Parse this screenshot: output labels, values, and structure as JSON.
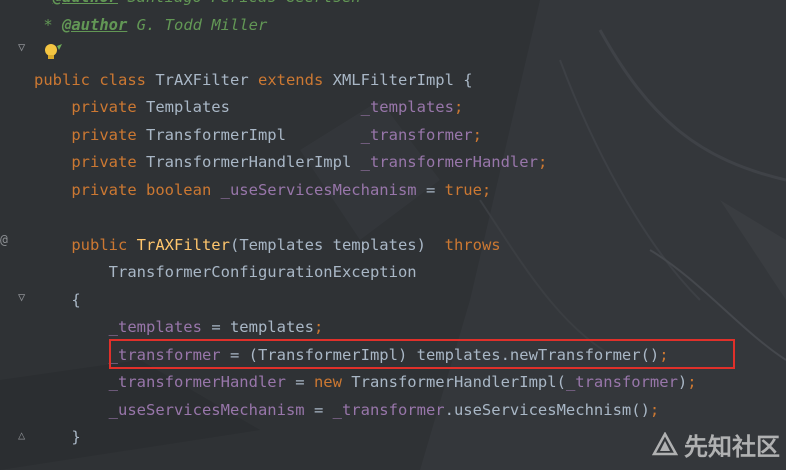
{
  "editor": {
    "lines": [
      {
        "segments": [
          {
            "cls": "cmt",
            "text": "  "
          },
          {
            "cls": "tag",
            "text": "@author"
          },
          {
            "cls": "cmt",
            "text": " Santiago Pericas-Geertsen"
          }
        ]
      },
      {
        "segments": [
          {
            "cls": "cmt",
            "text": " * "
          },
          {
            "cls": "tag",
            "text": "@author"
          },
          {
            "cls": "cmt",
            "text": " G. Todd Miller"
          }
        ]
      },
      {
        "segments": []
      },
      {
        "segments": [
          {
            "cls": "kw",
            "text": "public class "
          },
          {
            "cls": "cls",
            "text": "TrAXFilter "
          },
          {
            "cls": "kw",
            "text": "extends "
          },
          {
            "cls": "cls",
            "text": "XMLFilterImpl {"
          }
        ]
      },
      {
        "segments": [
          {
            "cls": "kw",
            "text": "    private "
          },
          {
            "cls": "cls",
            "text": "Templates              "
          },
          {
            "cls": "fld",
            "text": "_templates"
          },
          {
            "cls": "kw",
            "text": ";"
          }
        ]
      },
      {
        "segments": [
          {
            "cls": "kw",
            "text": "    private "
          },
          {
            "cls": "cls",
            "text": "TransformerImpl        "
          },
          {
            "cls": "fld",
            "text": "_transformer"
          },
          {
            "cls": "kw",
            "text": ";"
          }
        ]
      },
      {
        "segments": [
          {
            "cls": "kw",
            "text": "    private "
          },
          {
            "cls": "cls",
            "text": "TransformerHandlerImpl "
          },
          {
            "cls": "fld",
            "text": "_transformerHandler"
          },
          {
            "cls": "kw",
            "text": ";"
          }
        ]
      },
      {
        "segments": [
          {
            "cls": "kw",
            "text": "    private boolean "
          },
          {
            "cls": "fld",
            "text": "_useServicesMechanism"
          },
          {
            "cls": "plain",
            "text": " = "
          },
          {
            "cls": "kw",
            "text": "true;"
          }
        ]
      },
      {
        "segments": []
      },
      {
        "segments": [
          {
            "cls": "kw",
            "text": "    public "
          },
          {
            "cls": "ctor",
            "text": "TrAXFilter"
          },
          {
            "cls": "plain",
            "text": "(Templates templates)  "
          },
          {
            "cls": "kw",
            "text": "throws"
          }
        ]
      },
      {
        "segments": [
          {
            "cls": "plain",
            "text": "        TransformerConfigurationException"
          }
        ]
      },
      {
        "segments": [
          {
            "cls": "plain",
            "text": "    {"
          }
        ]
      },
      {
        "segments": [
          {
            "cls": "fld",
            "text": "        _templates"
          },
          {
            "cls": "plain",
            "text": " = templates"
          },
          {
            "cls": "kw",
            "text": ";"
          }
        ]
      },
      {
        "segments": [
          {
            "cls": "fld",
            "text": "        _transformer"
          },
          {
            "cls": "plain",
            "text": " = (TransformerImpl) templates.newTransformer()"
          },
          {
            "cls": "kw",
            "text": ";"
          }
        ]
      },
      {
        "segments": [
          {
            "cls": "fld",
            "text": "        _transformerHandler"
          },
          {
            "cls": "plain",
            "text": " = "
          },
          {
            "cls": "kw",
            "text": "new "
          },
          {
            "cls": "plain",
            "text": "TransformerHandlerImpl("
          },
          {
            "cls": "fld",
            "text": "_transformer"
          },
          {
            "cls": "plain",
            "text": ")"
          },
          {
            "cls": "kw",
            "text": ";"
          }
        ]
      },
      {
        "segments": [
          {
            "cls": "fld",
            "text": "        _useServicesMechanism"
          },
          {
            "cls": "plain",
            "text": " = "
          },
          {
            "cls": "fld",
            "text": "_transformer"
          },
          {
            "cls": "plain",
            "text": ".useServicesMechnism()"
          },
          {
            "cls": "kw",
            "text": ";"
          }
        ]
      },
      {
        "segments": [
          {
            "cls": "plain",
            "text": "    }"
          }
        ]
      }
    ]
  },
  "gutter": {
    "override_marker": "@",
    "fold_icons": [
      "fold-open-icon",
      "fold-open-icon",
      "fold-open-icon",
      "fold-close-icon"
    ]
  },
  "watermark": {
    "text": "先知社区",
    "logo_icon": "xianzhi-logo-icon"
  },
  "colors": {
    "keyword": "#cc7832",
    "field": "#9876aa",
    "constructor": "#ffc66d",
    "text": "#a9b7c6",
    "comment": "#629755",
    "highlight_border": "#e0302a"
  }
}
